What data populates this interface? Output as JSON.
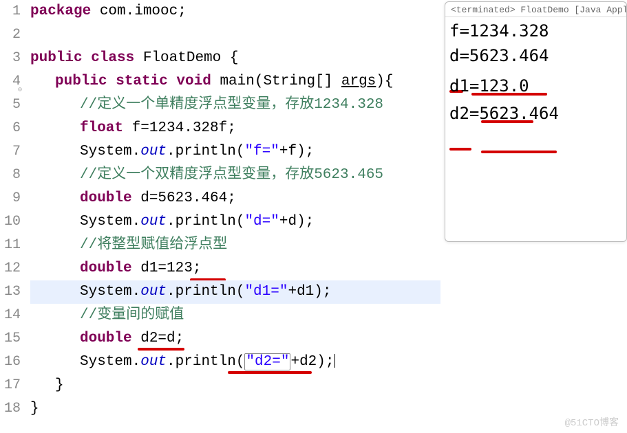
{
  "gutter": [
    "1",
    "2",
    "3",
    "4",
    "5",
    "6",
    "7",
    "8",
    "9",
    "10",
    "11",
    "12",
    "13",
    "14",
    "15",
    "16",
    "17",
    "18"
  ],
  "code": {
    "l1": {
      "kw": "package",
      "rest": " com.imooc;"
    },
    "l3": {
      "kw": "public class",
      "name": " FloatDemo {"
    },
    "l4": {
      "kw1": "public static void",
      "name": " main(String[] ",
      "kw2": "args",
      "rest": "){"
    },
    "l5": "//定义一个单精度浮点型变量，存放1234.328",
    "l6": {
      "kw": "float",
      "rest": " f=1234.328f;"
    },
    "l7": {
      "p1": "System.",
      "f": "out",
      "p2": ".println(",
      "s": "\"f=\"",
      "p3": "+f);"
    },
    "l8": "//定义一个双精度浮点型变量，存放5623.465",
    "l9": {
      "kw": "double",
      "rest": " d=5623.464;"
    },
    "l10": {
      "p1": "System.",
      "f": "out",
      "p2": ".println(",
      "s": "\"d=\"",
      "p3": "+d);"
    },
    "l11": "//将整型赋值给浮点型",
    "l12": {
      "kw": "double",
      "rest": " d1=123;"
    },
    "l13": {
      "p1": "System.",
      "f": "out",
      "p2": ".println(",
      "s": "\"d1=\"",
      "p3": "+d1);"
    },
    "l14": "//变量间的赋值",
    "l15": {
      "kw": "double",
      "rest": " d2=d;"
    },
    "l16": {
      "p1": "System.",
      "f": "out",
      "p2": ".println(",
      "s": "\"d2=\"",
      "p3": "+d2);"
    },
    "l17": "}",
    "l18": "}"
  },
  "console": {
    "title": "<terminated> FloatDemo [Java Application",
    "lines": [
      "f=1234.328",
      "d=5623.464",
      "d1=123.0",
      "d2=5623.464"
    ]
  },
  "watermark": "@51CTO博客"
}
